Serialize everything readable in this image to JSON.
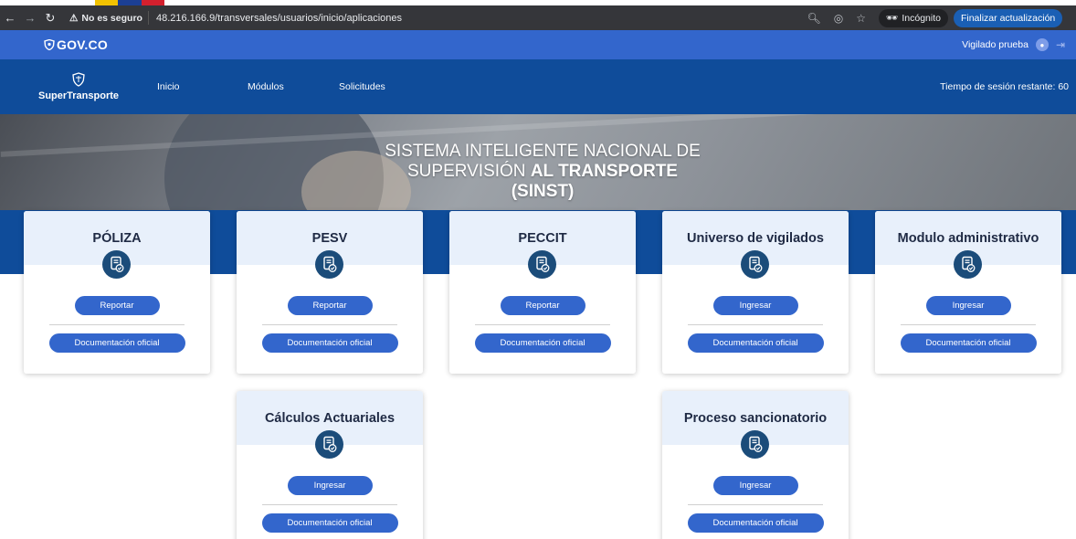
{
  "browser": {
    "security_warning": "No es seguro",
    "url": "48.216.166.9/transversales/usuarios/inicio/aplicaciones",
    "incognito_label": "Incógnito",
    "update_button": "Finalizar actualización"
  },
  "gov": {
    "logo_text": "GOV.CO",
    "user_name": "Vigilado prueba"
  },
  "header": {
    "brand": "SuperTransporte",
    "nav": [
      "Inicio",
      "Módulos",
      "Solicitudes"
    ],
    "session_text": "Tiempo de sesión restante: 60"
  },
  "hero": {
    "line1": "SISTEMA INTELIGENTE NACIONAL DE",
    "line2_normal": "SUPERVISIÓN",
    "line2_bold": "AL TRANSPORTE",
    "line3": "(SINST)"
  },
  "cards": [
    {
      "title": "PÓLIZA",
      "primary": "Reportar",
      "doc": "Documentación oficial"
    },
    {
      "title": "PESV",
      "primary": "Reportar",
      "doc": "Documentación oficial"
    },
    {
      "title": "PECCIT",
      "primary": "Reportar",
      "doc": "Documentación oficial"
    },
    {
      "title": "Universo de vigilados",
      "primary": "Ingresar",
      "doc": "Documentación oficial"
    },
    {
      "title": "Modulo administrativo",
      "primary": "Ingresar",
      "doc": "Documentación oficial"
    },
    {
      "title": "Cálculos Actuariales",
      "primary": "Ingresar",
      "doc": "Documentación oficial"
    },
    {
      "title": "Proceso sancionatorio",
      "primary": "Ingresar",
      "doc": "Documentación oficial"
    }
  ],
  "colors": {
    "gov_blue": "#3366cc",
    "header_blue": "#0f4c9a",
    "card_header": "#e8f0fb",
    "icon_circle": "#1b4c7a",
    "button": "#3366cc"
  }
}
